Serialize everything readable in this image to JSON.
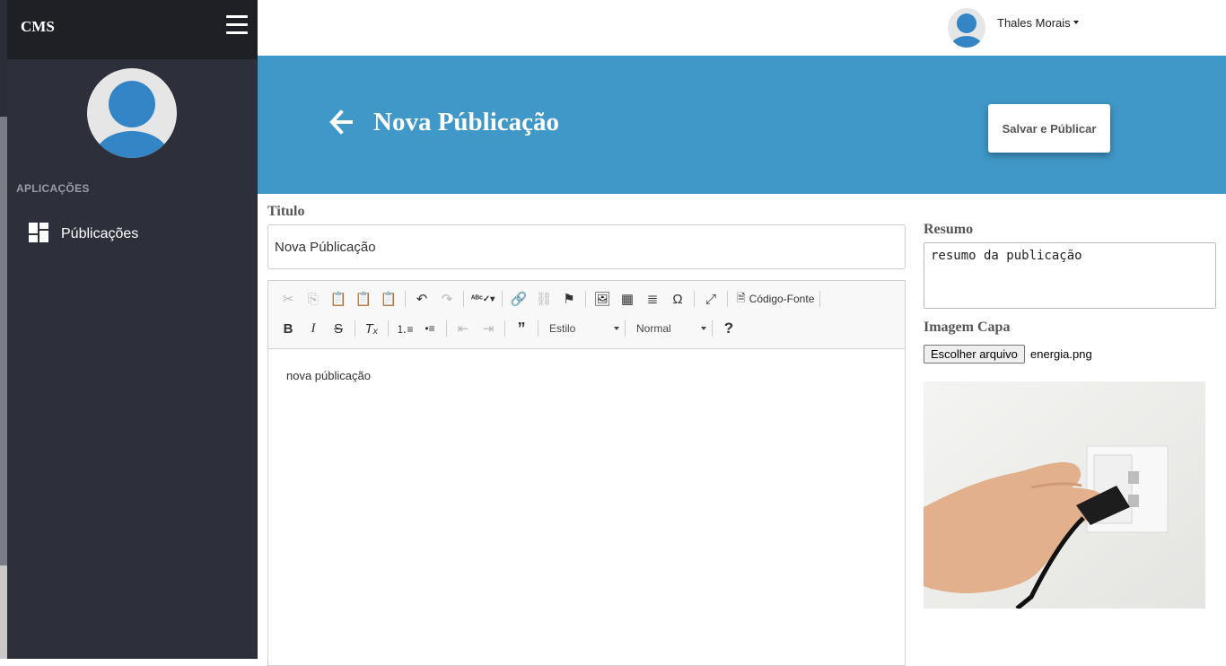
{
  "sidebar": {
    "brand": "CMS",
    "section_label": "APLICAÇÕES",
    "items": [
      {
        "label": "Públicações",
        "icon": "dashboard-grid-icon"
      }
    ]
  },
  "topbar": {
    "user_name": "Thales Morais"
  },
  "header": {
    "title": "Nova Públicação",
    "publish_label": "Salvar e Públicar",
    "color": "#3f98c7"
  },
  "form": {
    "title_label": "Titulo",
    "title_value": "Nova Públicação",
    "summary_label": "Resumo",
    "summary_value": "resumo da publicação",
    "cover_label": "Imagem Capa",
    "file_button": "Escolher arquivo",
    "file_name": "energia.png"
  },
  "editor": {
    "source_label": "Código-Fonte",
    "style_select": "Estilo",
    "format_select": "Normal",
    "content": "nova públicação"
  },
  "colors": {
    "sidebar": "#2d2f3a",
    "brandbar": "#1f2026",
    "accent": "#3f98c7"
  }
}
